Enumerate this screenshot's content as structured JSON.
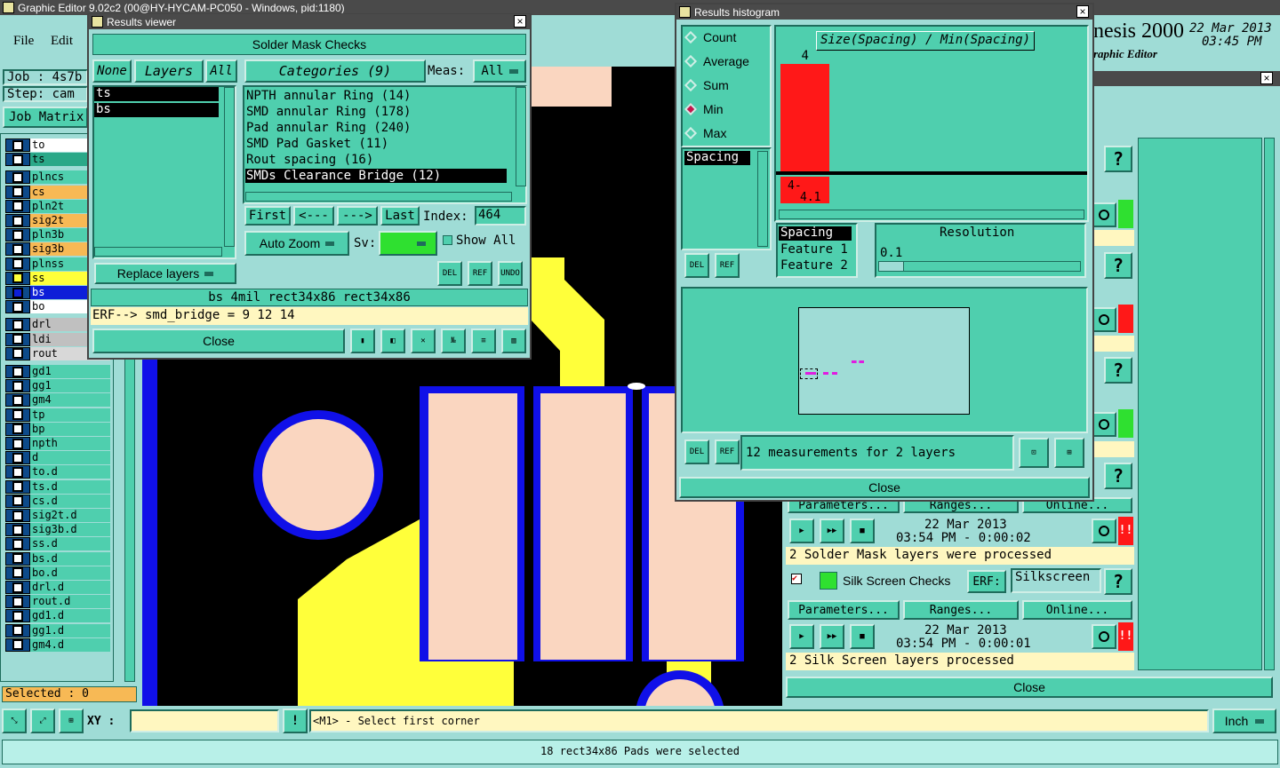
{
  "app": {
    "title": "Graphic Editor 9.02c2 (00@HY-HYCAM-PC050 - Windows, pid:1180)",
    "menu": [
      "File",
      "Edit"
    ],
    "job_label": "Job : 4s7b",
    "step_label": "Step: cam",
    "job_matrix": "Job Matrix",
    "selected": "Selected : 0",
    "layers": [
      "to",
      "ts",
      "plncs",
      "cs",
      "pln2t",
      "sig2t",
      "pln3b",
      "sig3b",
      "plnss",
      "ss",
      "bs",
      "bo",
      "drl",
      "ldi",
      "rout",
      "gd1",
      "gg1",
      "gm4",
      "tp",
      "bp",
      "npth",
      "d",
      "to.d",
      "ts.d",
      "cs.d",
      "sig2t.d",
      "sig3b.d",
      "ss.d",
      "bs.d",
      "bo.d",
      "drl.d",
      "rout.d",
      "gd1.d",
      "gg1.d",
      "gm4.d"
    ],
    "xy_label": "XY :",
    "prompt": "<M1> - Select first corner",
    "units": "Inch",
    "status": "18 rect34x86 Pads were selected"
  },
  "brand": {
    "name": "nesis 2000",
    "subtitle": "raphic Editor",
    "date": "22 Mar 2013",
    "time": "03:45 PM"
  },
  "colors": {
    "panel": "#4fcfae",
    "pale": "#9fdcd6",
    "pad": "#fad6c0",
    "yellow": "#ffff3a",
    "blue": "#1010e8",
    "red_bar": "#ff1818",
    "dark_titlebar": "#4a4a4a"
  },
  "results_viewer": {
    "title": "Results viewer",
    "header": "Solder Mask Checks",
    "layers_none": "None",
    "layers_label": "Layers",
    "layers_all": "All",
    "layers_list": [
      "ts",
      "bs"
    ],
    "categories_label": "Categories (9)",
    "meas_label": "Meas:",
    "meas_value": "All",
    "categories": [
      "NPTH annular Ring (14)",
      "SMD annular Ring (178)",
      "Pad annular Ring (240)",
      "SMD Pad Gasket (11)",
      "Rout spacing (16)",
      "SMDs Clearance Bridge (12)"
    ],
    "nav_first": "First",
    "nav_prev": "<---",
    "nav_next": "--->",
    "nav_last": "Last",
    "index_label": "Index:",
    "index_value": "464",
    "auto_zoom": "Auto Zoom",
    "sv_label": "Sv:",
    "show_all": "Show All",
    "replace_layers": "Replace layers",
    "del": "DEL",
    "ref": "REF",
    "undo": "UNDO",
    "info_line": "bs 4mil  rect34x86  rect34x86",
    "erf_line": "ERF--> smd_bridge = 9 12 14",
    "close": "Close"
  },
  "histogram": {
    "title": "Results histogram",
    "modes": [
      "Count",
      "Average",
      "Sum",
      "Min",
      "Max"
    ],
    "selected_mode": "Min",
    "measure_list": [
      "Spacing"
    ],
    "chart_title": "Size(Spacing) / Min(Spacing)",
    "bar_value_label": "4",
    "bin_label": "4-\n4.1",
    "features": [
      "Spacing",
      "Feature 1",
      "Feature 2"
    ],
    "resolution_label": "Resolution",
    "resolution_value": "0.1",
    "del": "DEL",
    "ref": "REF",
    "measurements": "12 measurements for 2 layers",
    "close": "Close"
  },
  "chart_data": {
    "type": "bar",
    "title": "Size(Spacing) / Min(Spacing)",
    "categories": [
      "4-4.1"
    ],
    "values": [
      4
    ],
    "data_labels": [
      "4"
    ]
  },
  "checks_panel": {
    "row1_date": "22 Mar 2013",
    "row1_time": "03:54 PM - 0:00:02",
    "row1_msg": "2 Solder Mask layers were processed",
    "silk_title": "Silk Screen Checks",
    "erf_label": "ERF:",
    "erf_value": "Silkscreen",
    "parameters": "Parameters...",
    "ranges": "Ranges...",
    "online": "Online...",
    "row2_date": "22 Mar 2013",
    "row2_time": "03:54 PM - 0:00:01",
    "row2_msg": "2 Silk Screen layers processed",
    "close": "Close"
  }
}
